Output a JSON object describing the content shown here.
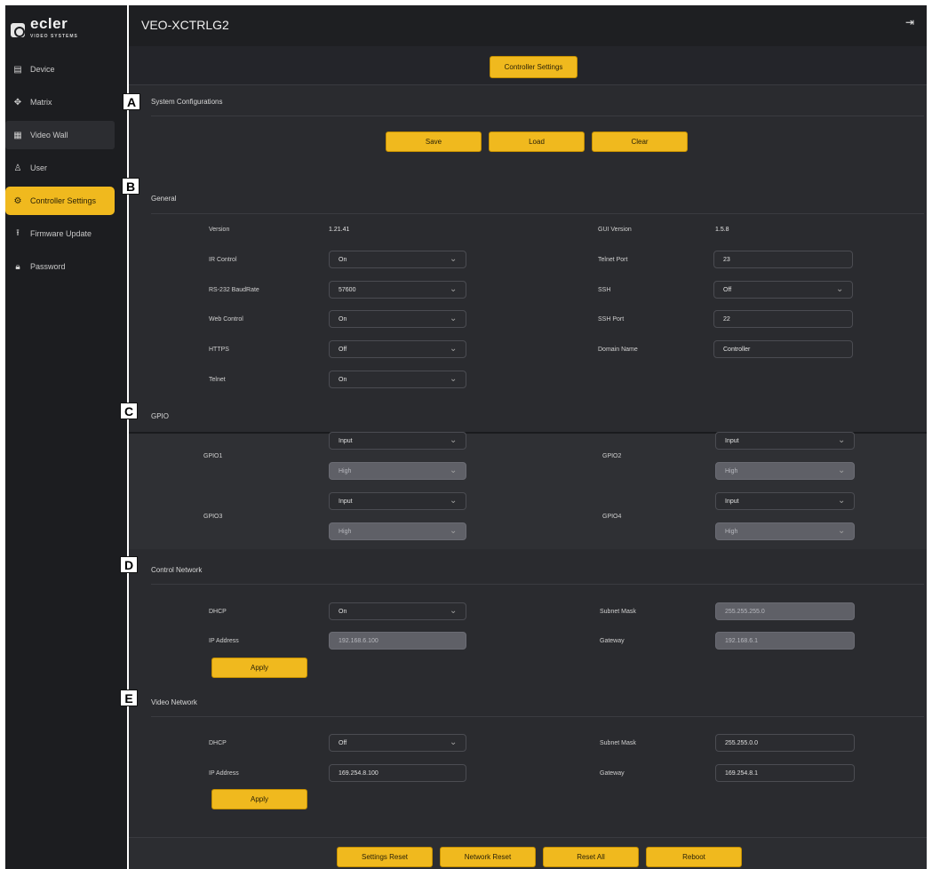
{
  "logo": {
    "text": "ecler",
    "sub": "VIDEO SYSTEMS"
  },
  "nav": {
    "items": [
      {
        "label": "Device",
        "icon": "device-icon"
      },
      {
        "label": "Matrix",
        "icon": "matrix-icon"
      },
      {
        "label": "Video Wall",
        "icon": "video-wall-icon"
      },
      {
        "label": "User",
        "icon": "user-icon"
      },
      {
        "label": "Controller Settings",
        "icon": "gear-icon"
      },
      {
        "label": "Firmware Update",
        "icon": "upload-icon"
      },
      {
        "label": "Password",
        "icon": "lock-icon"
      }
    ]
  },
  "header": {
    "title": "VEO-XCTRLG2",
    "tab": "Controller Settings"
  },
  "markers": {
    "a": "A",
    "b": "B",
    "c": "C",
    "d": "D",
    "e": "E"
  },
  "system": {
    "title": "System Configurations",
    "save": "Save",
    "load": "Load",
    "clear": "Clear"
  },
  "general": {
    "title": "General",
    "version_label": "Version",
    "version_value": "1.21.41",
    "gui_version_label": "GUI Version",
    "gui_version_value": "1.5.8",
    "ir_control_label": "IR Control",
    "ir_control_value": "On",
    "telnet_port_label": "Telnet Port",
    "telnet_port_value": "23",
    "baud_label": "RS-232 BaudRate",
    "baud_value": "57600",
    "ssh_label": "SSH",
    "ssh_value": "Off",
    "web_control_label": "Web Control",
    "web_control_value": "On",
    "ssh_port_label": "SSH Port",
    "ssh_port_value": "22",
    "https_label": "HTTPS",
    "https_value": "Off",
    "domain_label": "Domain Name",
    "domain_value": "Controller",
    "telnet_label": "Telnet",
    "telnet_value": "On"
  },
  "gpio": {
    "title": "GPIO",
    "gpio1_label": "GPIO1",
    "gpio1_mode": "Input",
    "gpio1_level": "High",
    "gpio2_label": "GPIO2",
    "gpio2_mode": "Input",
    "gpio2_level": "High",
    "gpio3_label": "GPIO3",
    "gpio3_mode": "Input",
    "gpio3_level": "High",
    "gpio4_label": "GPIO4",
    "gpio4_mode": "Input",
    "gpio4_level": "High"
  },
  "control_network": {
    "title": "Control Network",
    "dhcp_label": "DHCP",
    "dhcp_value": "On",
    "subnet_label": "Subnet Mask",
    "subnet_value": "255.255.255.0",
    "ip_label": "IP Address",
    "ip_value": "192.168.6.100",
    "gateway_label": "Gateway",
    "gateway_value": "192.168.6.1",
    "apply": "Apply"
  },
  "video_network": {
    "title": "Video Network",
    "dhcp_label": "DHCP",
    "dhcp_value": "Off",
    "subnet_label": "Subnet Mask",
    "subnet_value": "255.255.0.0",
    "ip_label": "IP Address",
    "ip_value": "169.254.8.100",
    "gateway_label": "Gateway",
    "gateway_value": "169.254.8.1",
    "apply": "Apply"
  },
  "footer": {
    "settings_reset": "Settings Reset",
    "network_reset": "Network Reset",
    "reset_all": "Reset All",
    "reboot": "Reboot"
  },
  "colors": {
    "accent": "#f0b91e",
    "sidebar": "#1c1d20",
    "panel": "#2a2b2f"
  }
}
